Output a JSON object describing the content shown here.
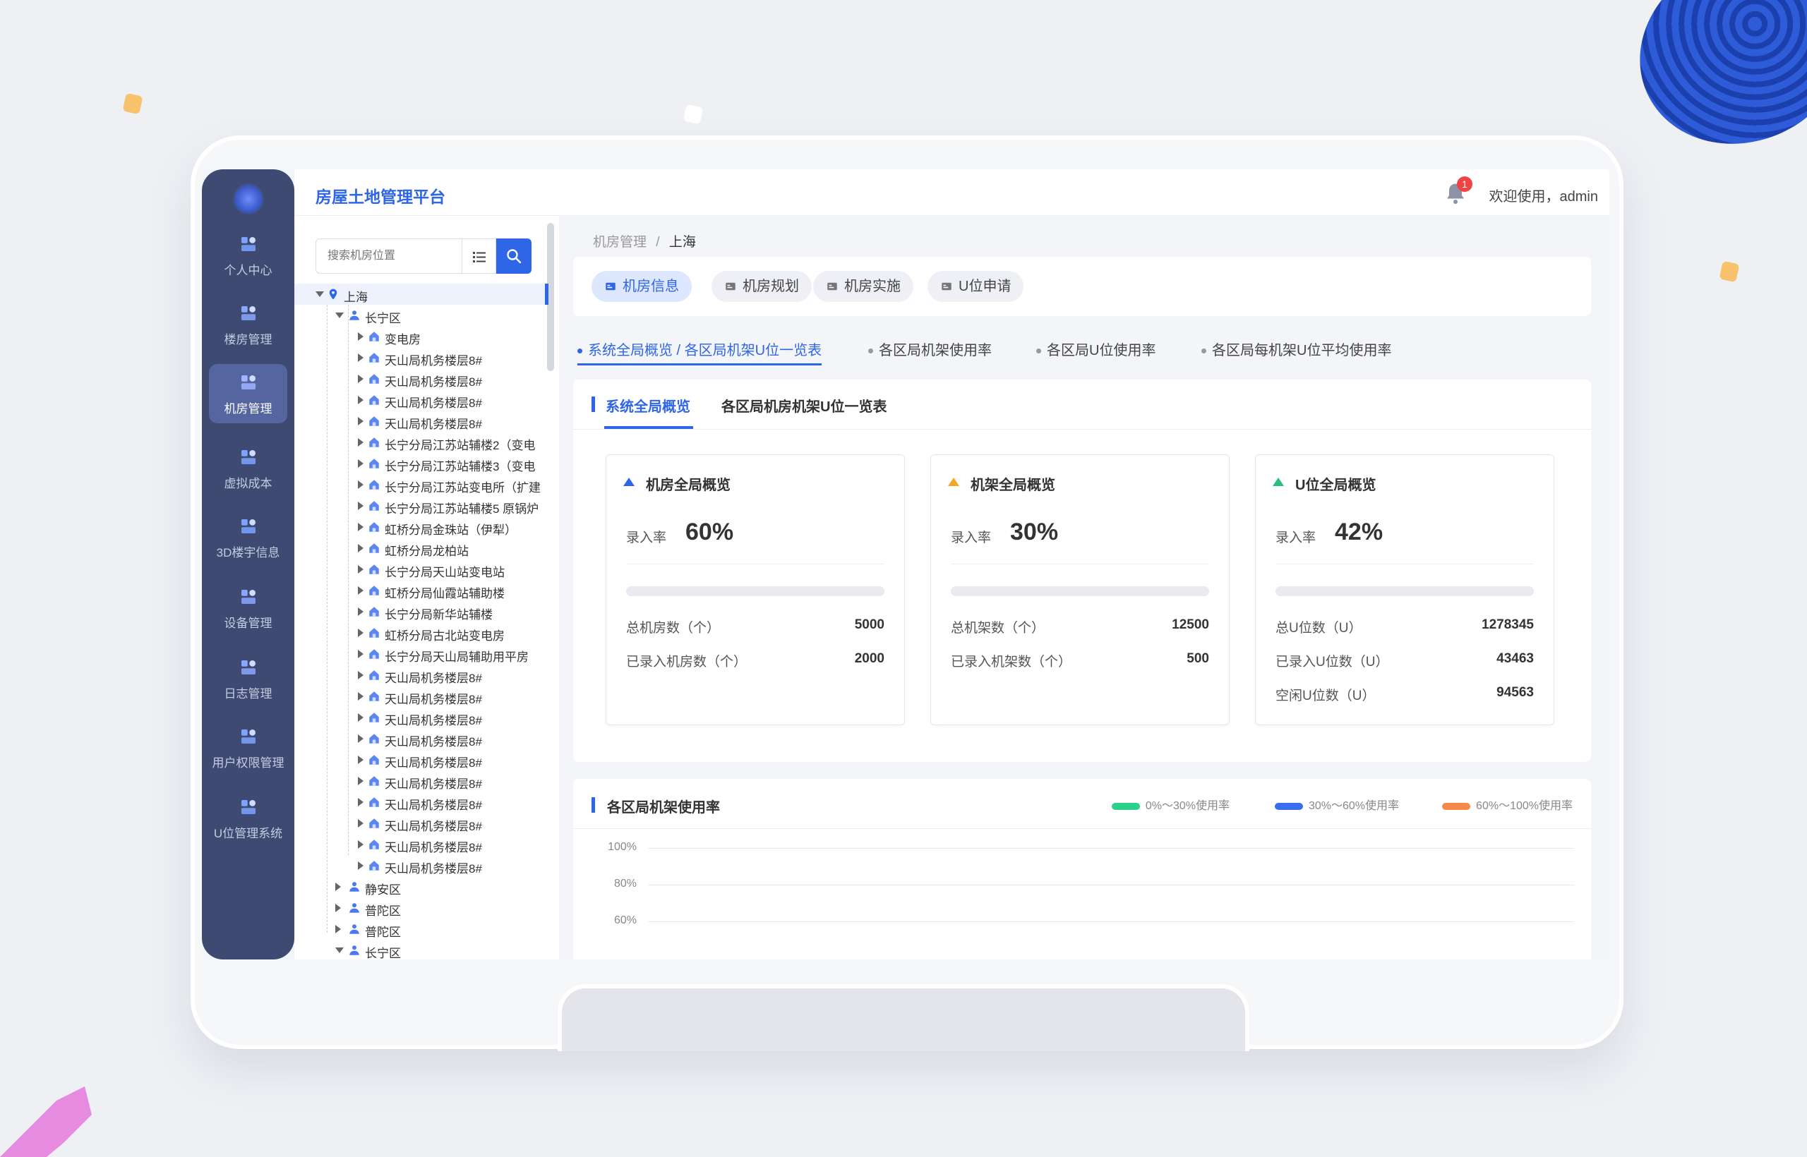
{
  "app": {
    "title": "房屋土地管理平台",
    "notification_count": "1",
    "welcome": "欢迎使用，admin"
  },
  "nav": {
    "items": [
      {
        "label": "个人中心",
        "icon": "person-center-icon"
      },
      {
        "label": "楼房管理",
        "icon": "building-icon"
      },
      {
        "label": "机房管理",
        "icon": "server-room-icon",
        "active": true
      },
      {
        "label": "虚拟成本",
        "icon": "cost-icon"
      },
      {
        "label": "3D楼宇信息",
        "icon": "cube-icon"
      },
      {
        "label": "设备管理",
        "icon": "device-icon"
      },
      {
        "label": "日志管理",
        "icon": "log-icon"
      },
      {
        "label": "用户权限管理",
        "icon": "user-permission-icon"
      },
      {
        "label": "U位管理系统",
        "icon": "u-slot-icon"
      }
    ]
  },
  "tree": {
    "search_placeholder": "搜索机房位置",
    "root": "上海",
    "district_1": "长宁区",
    "items": [
      "变电房",
      "天山局机务楼层8#",
      "天山局机务楼层8#",
      "天山局机务楼层8#",
      "天山局机务楼层8#",
      "长宁分局江苏站辅楼2（变电",
      "长宁分局江苏站辅楼3（变电",
      "长宁分局江苏站变电所（扩建",
      "长宁分局江苏站辅楼5 原锅炉",
      "虹桥分局金珠站（伊犁）",
      "虹桥分局龙柏站",
      "长宁分局天山站变电站",
      "虹桥分局仙霞站辅助楼",
      "长宁分局新华站辅楼",
      "虹桥分局古北站变电房",
      "长宁分局天山局辅助用平房",
      "天山局机务楼层8#",
      "天山局机务楼层8#",
      "天山局机务楼层8#",
      "天山局机务楼层8#",
      "天山局机务楼层8#",
      "天山局机务楼层8#",
      "天山局机务楼层8#",
      "天山局机务楼层8#",
      "天山局机务楼层8#",
      "天山局机务楼层8#"
    ],
    "districts_after": [
      "静安区",
      "普陀区",
      "普陀区",
      "长宁区"
    ]
  },
  "breadcrumb": {
    "parent": "机房管理",
    "separator": "/",
    "current": "上海"
  },
  "tabs": [
    {
      "label": "机房信息",
      "active": true
    },
    {
      "label": "机房规划"
    },
    {
      "label": "机房实施"
    },
    {
      "label": "U位申请"
    }
  ],
  "subnav": [
    {
      "label": "系统全局概览 / 各区局机架U位一览表",
      "active": true
    },
    {
      "label": "各区局机架使用率"
    },
    {
      "label": "各区局U位使用率"
    },
    {
      "label": "各区局每机架U位平均使用率"
    }
  ],
  "overview": {
    "tab_active": "系统全局概览",
    "tab_other": "各区局机房机架U位一览表",
    "cards": [
      {
        "title": "机房全局概览",
        "accent": "#2f66e8",
        "rate_label": "录入率",
        "rate": "60%",
        "rate_value": 0.6,
        "rows": [
          {
            "label": "总机房数（个）",
            "value": "5000"
          },
          {
            "label": "已录入机房数（个）",
            "value": "2000"
          }
        ]
      },
      {
        "title": "机架全局概览",
        "accent": "#f5a623",
        "rate_label": "录入率",
        "rate": "30%",
        "rate_value": 0.3,
        "rows": [
          {
            "label": "总机架数（个）",
            "value": "12500"
          },
          {
            "label": "已录入机架数（个）",
            "value": "500"
          }
        ]
      },
      {
        "title": "U位全局概览",
        "accent": "#2bbf7e",
        "rate_label": "录入率",
        "rate": "42%",
        "rate_value": 0.42,
        "rows": [
          {
            "label": "总U位数（U）",
            "value": "1278345"
          },
          {
            "label": "已录入U位数（U）",
            "value": "43463"
          },
          {
            "label": "空闲U位数（U）",
            "value": "94563"
          }
        ]
      }
    ]
  },
  "usage_chart": {
    "title": "各区局机架使用率",
    "legend": [
      {
        "label": "0%～30%使用率",
        "color": "#2bd08a"
      },
      {
        "label": "30%～60%使用率",
        "color": "#3a6ef0"
      },
      {
        "label": "60%～100%使用率",
        "color": "#f5894a"
      }
    ],
    "y_ticks": [
      "100%",
      "80%",
      "60%"
    ]
  }
}
